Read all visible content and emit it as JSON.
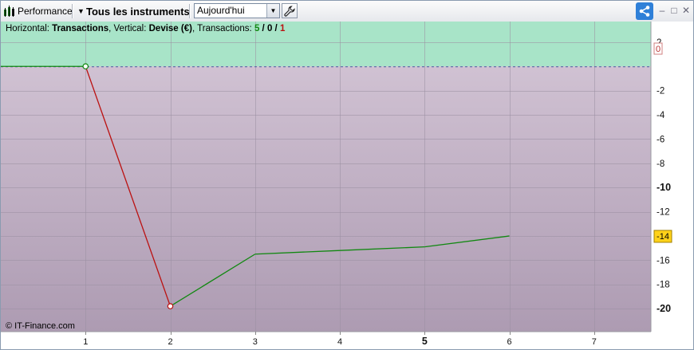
{
  "toolbar": {
    "performance_label": "Performance",
    "instruments_label": "Tous les instruments",
    "period_value": "Aujourd'hui"
  },
  "info": {
    "horizontal_prefix": "Horizontal: ",
    "horizontal_value": "Transactions",
    "vertical_prefix": ", Vertical: ",
    "vertical_value": "Devise (€)",
    "transactions_prefix": ", Transactions: ",
    "winners": "5",
    "separator1": " / ",
    "neutral": "0",
    "separator2": " / ",
    "losers": "1"
  },
  "copyright": "© IT-Finance.com",
  "colors": {
    "gain": "#118811",
    "loss": "#bb1111",
    "positive_zone": "#a8e4c8",
    "last_value_badge": "#ffd21a"
  },
  "chart_data": {
    "type": "line",
    "x_ticks": [
      "1",
      "2",
      "3",
      "4",
      "5",
      "6",
      "7"
    ],
    "y_ticks": [
      "2",
      "0",
      "-2",
      "-4",
      "-6",
      "-8",
      "-10",
      "-12",
      "-14",
      "-16",
      "-18",
      "-20"
    ],
    "xlim": [
      0,
      7.67
    ],
    "ylim": [
      -21.9,
      3.7
    ],
    "points": [
      {
        "x": 0,
        "y": 0
      },
      {
        "x": 1,
        "y": 0
      },
      {
        "x": 2,
        "y": -19.8
      },
      {
        "x": 3,
        "y": -15.5
      },
      {
        "x": 4,
        "y": -15.2
      },
      {
        "x": 5,
        "y": -14.9
      },
      {
        "x": 6,
        "y": -14.0
      }
    ],
    "zero_marker_label": "0",
    "last_value_label": "-14",
    "grid": true
  }
}
